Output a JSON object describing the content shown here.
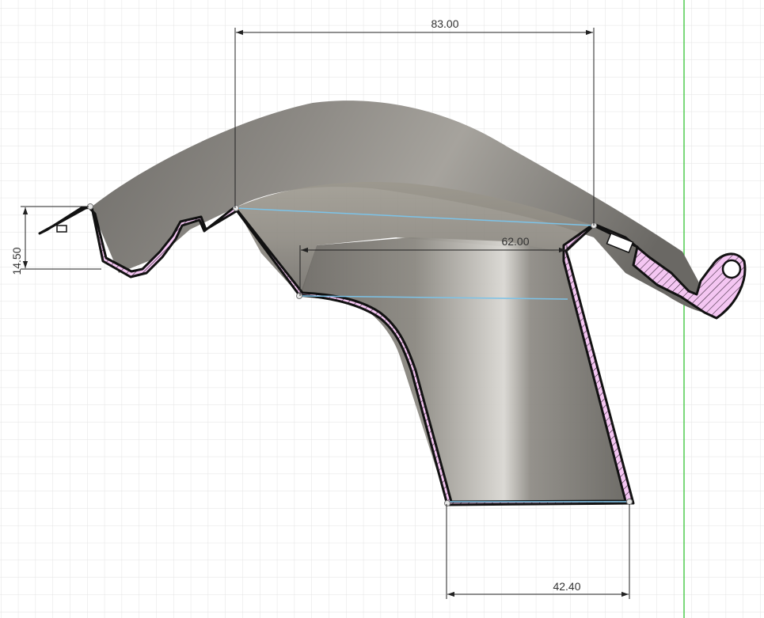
{
  "view": {
    "background": "#ffffff",
    "grid_minor_color": "#e3e3e3",
    "grid_major_color": "#cfcfcf",
    "axis_color": "#43c843"
  },
  "section": {
    "hatch_fill": "#f4c6f2",
    "outline_color": "#111111",
    "body_color": "#8a8883"
  },
  "dimensions": {
    "overall_width": "83.00",
    "mid_width": "62.00",
    "bottom_width": "42.40",
    "left_height": "14.50"
  },
  "construction_line_color": "#7cc3e8",
  "dimension_line_color": "#222222"
}
